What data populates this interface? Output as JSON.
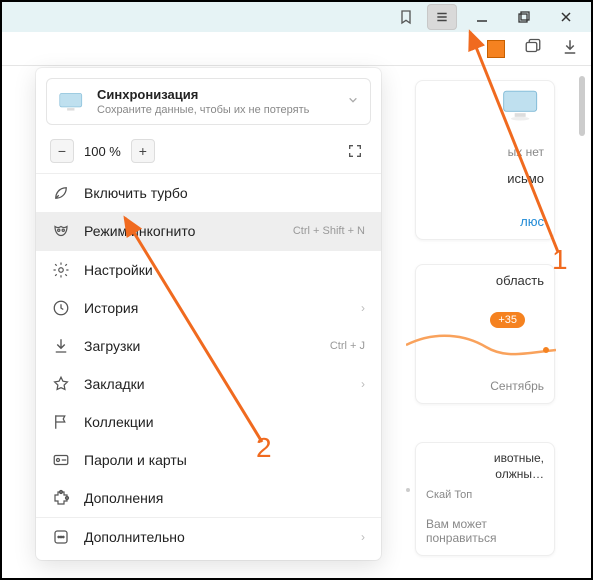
{
  "titlebar": {
    "icons": {
      "bookmark": "bookmark-icon",
      "menu": "menu-icon",
      "minimize": "minimize-icon",
      "maximize": "maximize-icon",
      "close": "close-icon"
    }
  },
  "toolbar": {
    "icons": {
      "tile": "tile-icon",
      "tabs": "tabs-icon",
      "download": "download-icon"
    }
  },
  "sync_card": {
    "title": "Синхронизация",
    "subtitle": "Сохраните данные, чтобы их не потерять"
  },
  "zoom": {
    "minus": "−",
    "value": "100 %",
    "plus": "+",
    "fullscreen_icon": "fullscreen-icon"
  },
  "menu": {
    "turbo": "Включить турбо",
    "incognito": "Режим инкогнито",
    "incognito_shortcut": "Ctrl + Shift + N",
    "settings": "Настройки",
    "history": "История",
    "downloads": "Загрузки",
    "downloads_shortcut": "Ctrl + J",
    "bookmarks": "Закладки",
    "collections": "Коллекции",
    "passwords": "Пароли и карты",
    "extensions": "Дополнения",
    "more": "Дополнительно"
  },
  "bg": {
    "no_items": "ых нет",
    "letter": "исьмо",
    "plus_link": "люс",
    "region": "область",
    "temperature": "+35",
    "month": "Сентябрь",
    "animals1": "ивотные,",
    "animals2": "олжны…",
    "source": "Скай Топ",
    "suggest": "Вам может понравиться"
  },
  "annotations": {
    "one": "1",
    "two": "2"
  }
}
